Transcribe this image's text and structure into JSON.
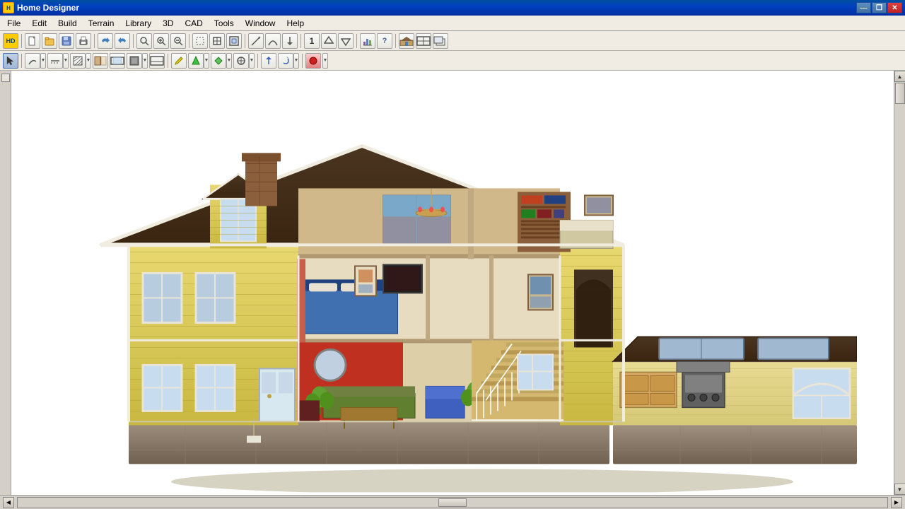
{
  "titlebar": {
    "app_name": "Home Designer",
    "minimize_label": "—",
    "restore_label": "❐",
    "close_label": "✕"
  },
  "menubar": {
    "items": [
      "File",
      "Edit",
      "Build",
      "Terrain",
      "Library",
      "3D",
      "CAD",
      "Tools",
      "Window",
      "Help"
    ]
  },
  "toolbar1": {
    "buttons": [
      {
        "name": "new",
        "icon": "📄"
      },
      {
        "name": "open",
        "icon": "📂"
      },
      {
        "name": "save",
        "icon": "💾"
      },
      {
        "name": "print",
        "icon": "🖨"
      },
      {
        "name": "undo",
        "icon": "↩"
      },
      {
        "name": "redo",
        "icon": "↪"
      },
      {
        "name": "search",
        "icon": "🔍"
      },
      {
        "name": "zoom-in",
        "icon": "+🔍"
      },
      {
        "name": "zoom-out",
        "icon": "-🔍"
      },
      {
        "name": "select-box",
        "icon": "⬜"
      },
      {
        "name": "full-screen",
        "icon": "⛶"
      },
      {
        "name": "fit-page",
        "icon": "⊞"
      },
      {
        "name": "draw-wall",
        "icon": "+"
      },
      {
        "name": "draw-arch",
        "icon": "⌒"
      },
      {
        "name": "arrow-down",
        "icon": "▼"
      },
      {
        "name": "counter",
        "icon": "1"
      },
      {
        "name": "roof-up",
        "icon": "△"
      },
      {
        "name": "roof-down",
        "icon": "▽"
      },
      {
        "name": "library",
        "icon": "📚"
      },
      {
        "name": "help",
        "icon": "?"
      },
      {
        "name": "exterior",
        "icon": "🏠"
      },
      {
        "name": "floor-plan",
        "icon": "📐"
      },
      {
        "name": "3d-view",
        "icon": "🔲"
      }
    ]
  },
  "toolbar2": {
    "buttons": [
      {
        "name": "select-arrow",
        "icon": "↖"
      },
      {
        "name": "poly-line",
        "icon": "⌒"
      },
      {
        "name": "line-style",
        "icon": "—"
      },
      {
        "name": "hatch",
        "icon": "▦"
      },
      {
        "name": "door-symbol",
        "icon": "🚪"
      },
      {
        "name": "window-symbol",
        "icon": "⬜"
      },
      {
        "name": "fixture",
        "icon": "⬛"
      },
      {
        "name": "elevation",
        "icon": "⬜"
      },
      {
        "name": "edit-tool",
        "icon": "✏"
      },
      {
        "name": "color-fill",
        "icon": "▲"
      },
      {
        "name": "pattern",
        "icon": "◆"
      },
      {
        "name": "transform",
        "icon": "⊕"
      },
      {
        "name": "up-arrow",
        "icon": "↑"
      },
      {
        "name": "rotate",
        "icon": "↺"
      },
      {
        "name": "record",
        "icon": "⏺"
      }
    ]
  },
  "canvas": {
    "background": "#ffffff",
    "house_description": "3D house cross-section view showing multiple floors with furniture and interior details"
  },
  "statusbar": {
    "scroll_left": "◀",
    "scroll_right": "▶",
    "scroll_up": "▲",
    "scroll_down": "▼"
  }
}
